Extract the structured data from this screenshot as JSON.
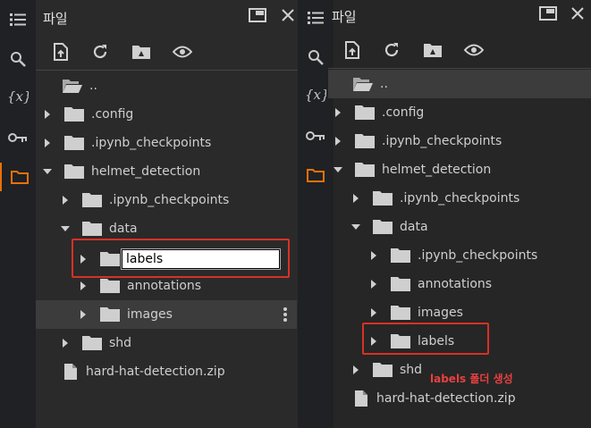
{
  "left": {
    "title": "파일",
    "rows": [
      {
        "label": ".."
      },
      {
        "label": ".config"
      },
      {
        "label": ".ipynb_checkpoints"
      },
      {
        "label": "helmet_detection"
      },
      {
        "label": ".ipynb_checkpoints"
      },
      {
        "label": "data"
      },
      {
        "label": "annotations"
      },
      {
        "label": "images"
      },
      {
        "label": "shd"
      },
      {
        "label": "hard-hat-detection.zip"
      }
    ],
    "rename_value": "labels"
  },
  "right": {
    "title": "파일",
    "rows": [
      {
        "label": ".."
      },
      {
        "label": ".config"
      },
      {
        "label": ".ipynb_checkpoints"
      },
      {
        "label": "helmet_detection"
      },
      {
        "label": "data"
      },
      {
        "label": ".ipynb_checkpoints"
      },
      {
        "label": "annotations"
      },
      {
        "label": "images"
      },
      {
        "label": "labels"
      },
      {
        "label": "shd"
      },
      {
        "label": "hard-hat-detection.zip"
      }
    ],
    "caption": "labels 폴더 생성"
  },
  "colors": {
    "accent": "#e8710a",
    "highlight": "#d93025"
  },
  "icons": [
    "list-icon",
    "search-icon",
    "variables-icon",
    "key-icon",
    "folder-icon",
    "upload-icon",
    "refresh-icon",
    "drive-folder-icon",
    "eye-icon",
    "window-icon",
    "close-icon"
  ]
}
